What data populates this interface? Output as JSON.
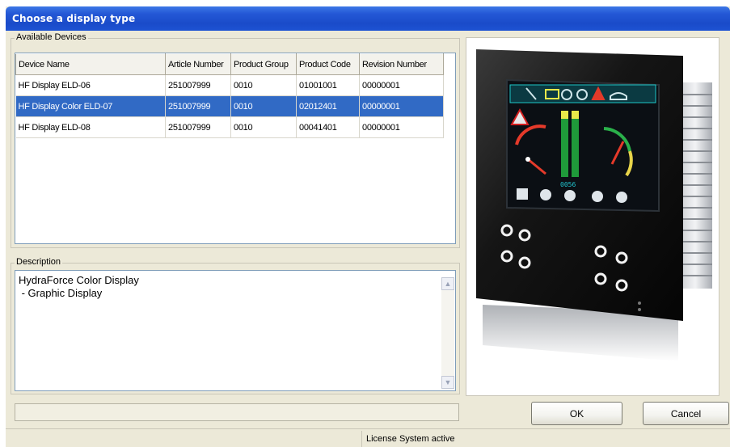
{
  "window": {
    "title": "Choose a display type"
  },
  "devices": {
    "group_label": "Available Devices",
    "columns": [
      "Device Name",
      "Article Number",
      "Product Group",
      "Product Code",
      "Revision Number"
    ],
    "rows": [
      [
        "HF Display ELD-06",
        "251007999",
        "0010",
        "01001001",
        "00000001"
      ],
      [
        "HF Display Color ELD-07",
        "251007999",
        "0010",
        "02012401",
        "00000001"
      ],
      [
        "HF Display ELD-08",
        "251007999",
        "0010",
        "00041401",
        "00000001"
      ]
    ],
    "selected_index": 1
  },
  "description": {
    "group_label": "Description",
    "text": "HydraForce Color Display\n - Graphic Display"
  },
  "preview": {
    "readout": "0056"
  },
  "buttons": {
    "ok": "OK",
    "cancel": "Cancel"
  },
  "status": {
    "text": "License System active"
  },
  "colors": {
    "titlebar": "#2458d6",
    "selection": "#316ac5",
    "dialog_bg": "#ece9d8"
  }
}
